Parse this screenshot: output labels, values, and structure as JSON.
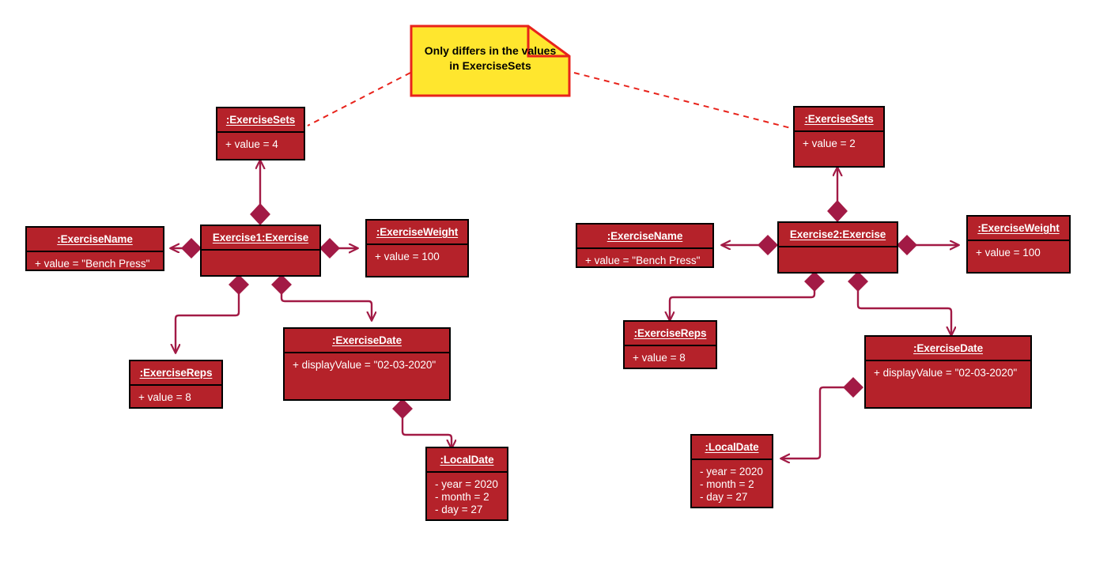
{
  "diagram": {
    "title": "UML Object Diagram - Exercise instances",
    "background": "#ffffff",
    "box_fill": "#b5222a",
    "box_border": "#000000",
    "text_color": "#ffffff",
    "edge_color": "#a21a45",
    "note_fill": "#ffe62e",
    "note_border": "#e8231b",
    "note_link_color": "#e8231b"
  },
  "note": {
    "name": "comment-note",
    "line1": "Only differs in the values",
    "line2": "in ExerciseSets"
  },
  "objects": [
    {
      "id": "left-exercisesets",
      "name": "object-exercisesets-left",
      "title": ":ExerciseSets",
      "attrs": [
        "+ value = 4"
      ]
    },
    {
      "id": "left-exercisename",
      "name": "object-exercisename-left",
      "title": ":ExerciseName",
      "attrs": [
        "+ value = \"Bench Press\""
      ]
    },
    {
      "id": "left-exercise",
      "name": "object-exercise1",
      "title": "Exercise1:Exercise",
      "attrs": []
    },
    {
      "id": "left-exerciseweight",
      "name": "object-exerciseweight-left",
      "title": ":ExerciseWeight",
      "attrs": [
        "+ value = 100"
      ]
    },
    {
      "id": "left-exercisereps",
      "name": "object-exercisereps-left",
      "title": ":ExerciseReps",
      "attrs": [
        "+ value = 8"
      ]
    },
    {
      "id": "left-exercisedate",
      "name": "object-exercisedate-left",
      "title": ":ExerciseDate",
      "attrs": [
        "+ displayValue = \"02-03-2020\""
      ]
    },
    {
      "id": "left-localdate",
      "name": "object-localdate-left",
      "title": ":LocalDate",
      "attrs": [
        "- year = 2020",
        "- month = 2",
        "- day = 27"
      ]
    },
    {
      "id": "right-exercisesets",
      "name": "object-exercisesets-right",
      "title": ":ExerciseSets",
      "attrs": [
        "+ value = 2"
      ]
    },
    {
      "id": "right-exercisename",
      "name": "object-exercisename-right",
      "title": ":ExerciseName",
      "attrs": [
        "+ value = \"Bench Press\""
      ]
    },
    {
      "id": "right-exercise",
      "name": "object-exercise2",
      "title": "Exercise2:Exercise",
      "attrs": []
    },
    {
      "id": "right-exerciseweight",
      "name": "object-exerciseweight-right",
      "title": ":ExerciseWeight",
      "attrs": [
        "+ value = 100"
      ]
    },
    {
      "id": "right-exercisereps",
      "name": "object-exercisereps-right",
      "title": ":ExerciseReps",
      "attrs": [
        "+ value = 8"
      ]
    },
    {
      "id": "right-exercisedate",
      "name": "object-exercisedate-right",
      "title": ":ExerciseDate",
      "attrs": [
        "+ displayValue = \"02-03-2020\""
      ]
    },
    {
      "id": "right-localdate",
      "name": "object-localdate-right",
      "title": ":LocalDate",
      "attrs": [
        "- year = 2020",
        "- month = 2",
        "- day = 27"
      ]
    }
  ],
  "relations": [
    {
      "from": "left-exercise",
      "to": "left-exercisesets",
      "kind": "composition"
    },
    {
      "from": "left-exercise",
      "to": "left-exercisename",
      "kind": "composition"
    },
    {
      "from": "left-exercise",
      "to": "left-exerciseweight",
      "kind": "composition"
    },
    {
      "from": "left-exercise",
      "to": "left-exercisereps",
      "kind": "composition"
    },
    {
      "from": "left-exercise",
      "to": "left-exercisedate",
      "kind": "composition"
    },
    {
      "from": "left-exercisedate",
      "to": "left-localdate",
      "kind": "composition"
    },
    {
      "from": "right-exercise",
      "to": "right-exercisesets",
      "kind": "composition"
    },
    {
      "from": "right-exercise",
      "to": "right-exercisename",
      "kind": "composition"
    },
    {
      "from": "right-exercise",
      "to": "right-exerciseweight",
      "kind": "composition"
    },
    {
      "from": "right-exercise",
      "to": "right-exercisereps",
      "kind": "composition"
    },
    {
      "from": "right-exercise",
      "to": "right-exercisedate",
      "kind": "composition"
    },
    {
      "from": "right-exercisedate",
      "to": "right-localdate",
      "kind": "composition"
    }
  ]
}
